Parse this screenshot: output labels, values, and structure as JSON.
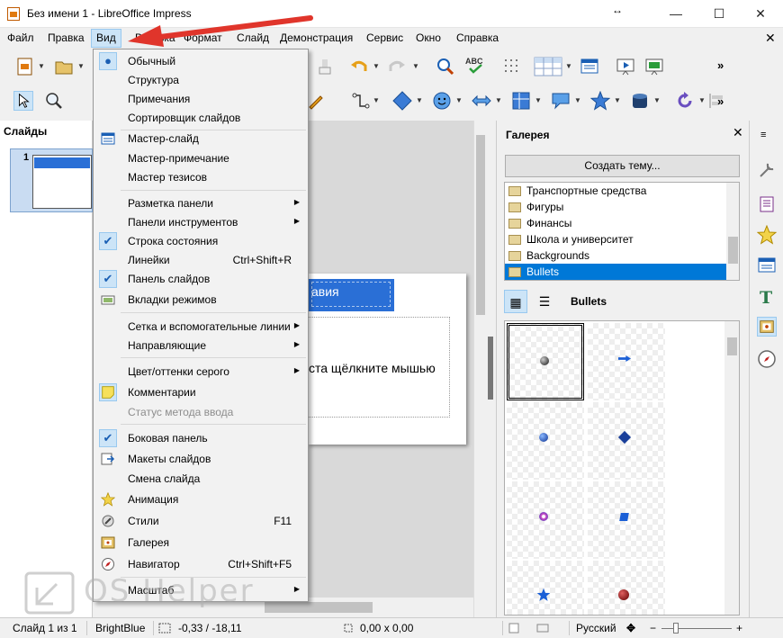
{
  "window": {
    "title": "Без имени 1 - LibreOffice Impress",
    "minimize": "—",
    "maximize": "☐",
    "close": "✕",
    "resize": "↔"
  },
  "menubar": {
    "items": [
      "Файл",
      "Правка",
      "Вид",
      "Вставка",
      "Формат",
      "Слайд",
      "Демонстрация",
      "Сервис",
      "Окно",
      "Справка"
    ],
    "active": "Вид",
    "close_doc": "✕"
  },
  "slides_pane": {
    "title": "Слайды",
    "slide_number": "1"
  },
  "slide": {
    "title_fragment": "авия",
    "body_fragment": "ста щёлкните мышью"
  },
  "gallery": {
    "title": "Галерея",
    "close": "✕",
    "new_theme_button": "Создать тему...",
    "themes": [
      "Транспортные средства",
      "Фигуры",
      "Финансы",
      "Школа и университет",
      "Backgrounds",
      "Bullets"
    ],
    "selected_theme": "Bullets",
    "view_title": "Bullets",
    "icon_view_glyph": "▦",
    "list_view_glyph": "☰"
  },
  "view_menu": {
    "items": [
      {
        "label": "Обычный",
        "state": "radio"
      },
      {
        "label": "Структура"
      },
      {
        "label": "Примечания"
      },
      {
        "label": "Сортировщик слайдов"
      },
      {
        "label": "Мастер-слайд",
        "icon": "master-slide-icon"
      },
      {
        "label": "Мастер-примечание"
      },
      {
        "label": "Мастер тезисов"
      },
      {
        "label": "Разметка панели",
        "submenu": true
      },
      {
        "label": "Панели инструментов",
        "submenu": true
      },
      {
        "label": "Строка состояния",
        "state": "checked"
      },
      {
        "label": "Линейки",
        "shortcut": "Ctrl+Shift+R"
      },
      {
        "label": "Панель слайдов",
        "state": "checked"
      },
      {
        "label": "Вкладки режимов",
        "icon": "mode-tabs-icon"
      },
      {
        "label": "Сетка и вспомогательные линии",
        "submenu": true
      },
      {
        "label": "Направляющие",
        "submenu": true
      },
      {
        "label": "Цвет/оттенки серого",
        "submenu": true
      },
      {
        "label": "Комментарии",
        "icon": "comment-icon"
      },
      {
        "label": "Статус метода ввода",
        "disabled": true
      },
      {
        "label": "Боковая панель",
        "state": "checked"
      },
      {
        "label": "Макеты слайдов",
        "icon": "slide-layouts-icon"
      },
      {
        "label": "Смена слайда"
      },
      {
        "label": "Анимация",
        "icon": "animation-icon"
      },
      {
        "label": "Стили",
        "shortcut": "F11",
        "icon": "styles-icon"
      },
      {
        "label": "Галерея",
        "icon": "gallery-icon"
      },
      {
        "label": "Навигатор",
        "shortcut": "Ctrl+Shift+F5",
        "icon": "navigator-icon"
      },
      {
        "label": "Масштаб",
        "submenu": true
      }
    ],
    "check_glyph": "✔",
    "radio_glyph": "●",
    "submenu_glyph": "▶"
  },
  "statusbar": {
    "slide_info": "Слайд 1 из 1",
    "master": "BrightBlue",
    "position": "-0,33 / -18,11",
    "size": "0,00 x 0,00",
    "language": "Русский"
  },
  "watermark": {
    "text": "OS Helper"
  },
  "colors": {
    "accent": "#0078d7",
    "menu_highlight": "#cce4f7",
    "slide_title_blue": "#2a6fd6",
    "annotation_red": "#e0352b"
  }
}
